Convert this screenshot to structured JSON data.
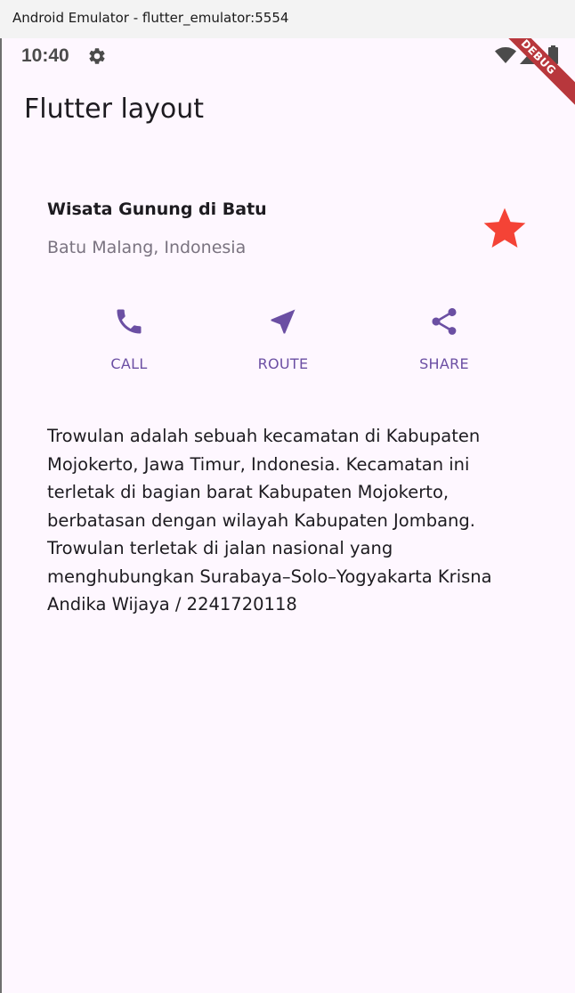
{
  "window": {
    "title": "Android Emulator - flutter_emulator:5554"
  },
  "status_bar": {
    "time": "10:40",
    "icons": [
      "gear-icon",
      "wifi-icon",
      "signal-icon",
      "battery-icon"
    ]
  },
  "debug_banner": "DEBUG",
  "app_bar": {
    "title": "Flutter layout"
  },
  "title_section": {
    "name": "Wisata Gunung di Batu",
    "location": "Batu Malang, Indonesia",
    "star_icon": "star-icon",
    "star_color": "#f44336"
  },
  "actions": [
    {
      "label": "CALL",
      "icon": "phone-icon"
    },
    {
      "label": "ROUTE",
      "icon": "navigation-icon"
    },
    {
      "label": "SHARE",
      "icon": "share-icon"
    }
  ],
  "accent_color": "#6b4fa3",
  "description": "Trowulan adalah sebuah kecamatan di Kabupaten Mojokerto, Jawa Timur, Indonesia. Kecamatan ini terletak di bagian barat Kabupaten Mojokerto, berbatasan dengan wilayah Kabupaten Jombang. Trowulan terletak di jalan nasional yang menghubungkan Surabaya–Solo–Yogyakarta Krisna Andika Wijaya / 2241720118"
}
